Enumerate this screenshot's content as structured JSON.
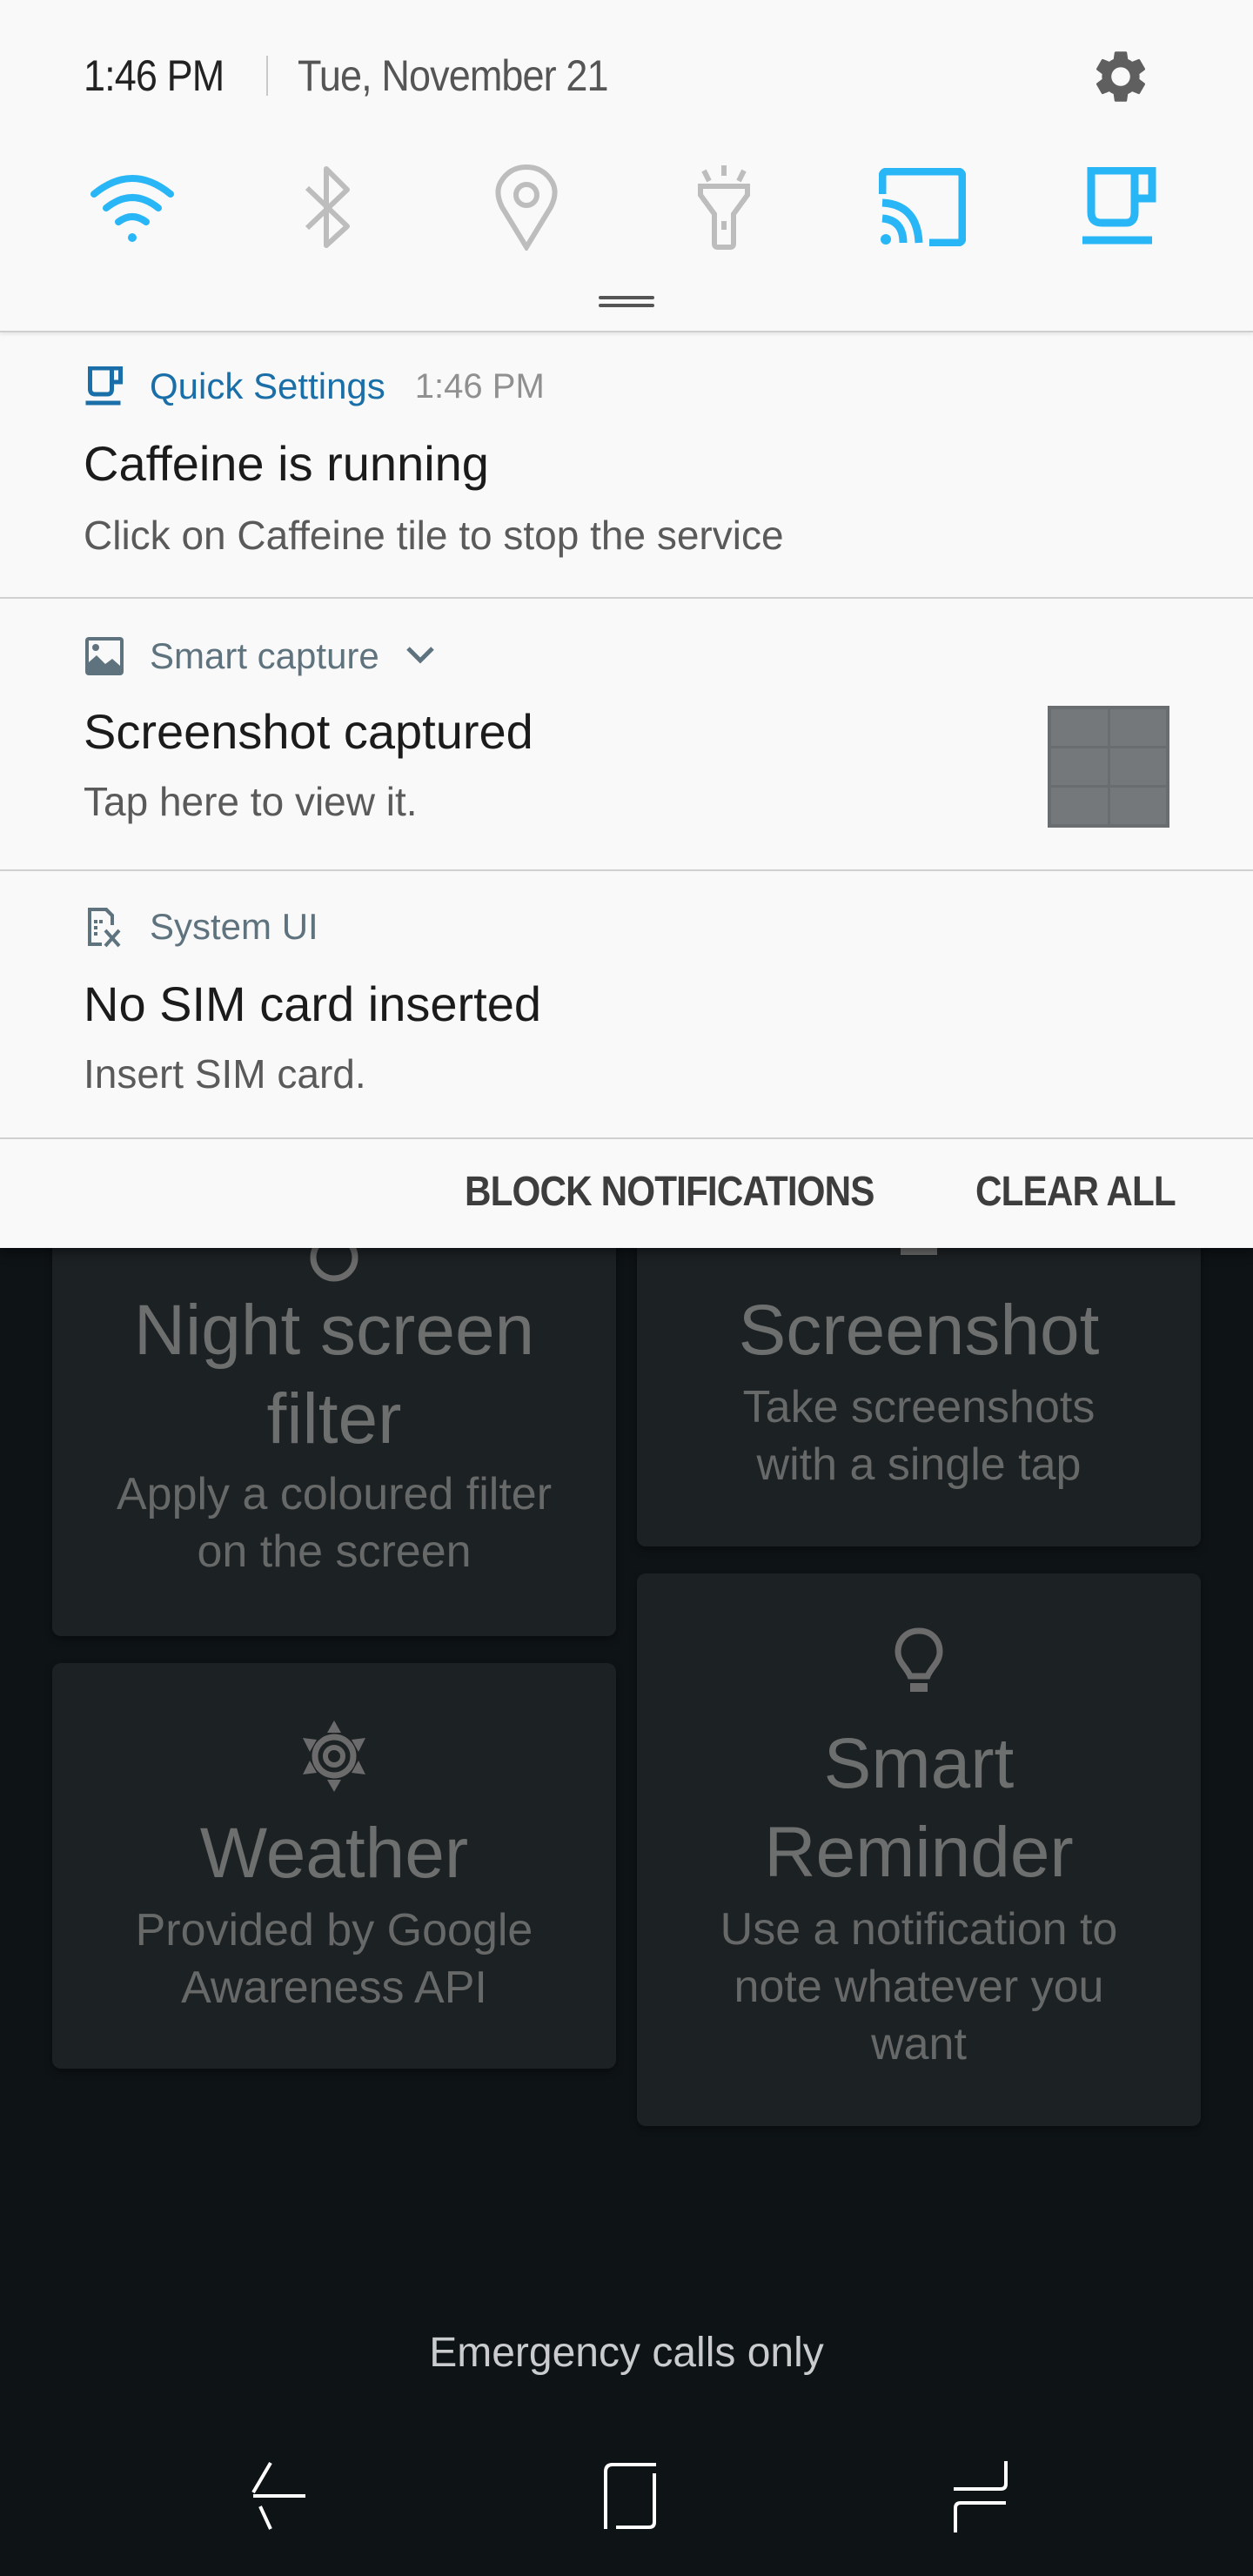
{
  "status_header": {
    "time": "1:46 PM",
    "date": "Tue, November 21",
    "settings_icon": "gear-icon"
  },
  "quick_toggles": [
    {
      "name": "wifi",
      "icon": "wifi-icon",
      "state": "on"
    },
    {
      "name": "bluetooth",
      "icon": "bluetooth-icon",
      "state": "off"
    },
    {
      "name": "location",
      "icon": "location-icon",
      "state": "off"
    },
    {
      "name": "flashlight",
      "icon": "flashlight-icon",
      "state": "off"
    },
    {
      "name": "cast",
      "icon": "cast-icon",
      "state": "on"
    },
    {
      "name": "caffeine",
      "icon": "coffee-cup-icon",
      "state": "on"
    }
  ],
  "colors": {
    "toggle_on": "#29b6f6",
    "toggle_off": "#bdbdbd",
    "quick_settings_app": "#1a6fa8",
    "app_name": "#5f737e",
    "panel_bg": "#f9f9f9",
    "background": "#0e1316",
    "tile_bg": "#1c2124"
  },
  "notifications": [
    {
      "app_name": "Quick Settings",
      "time": "1:46 PM",
      "icon": "coffee-cup-icon",
      "title": "Caffeine is running",
      "body": "Click on Caffeine tile to stop the service"
    },
    {
      "app_name": "Smart capture",
      "icon": "image-icon",
      "expandable": true,
      "title": "Screenshot captured",
      "body": "Tap here to view it.",
      "has_thumbnail": true
    },
    {
      "app_name": "System UI",
      "icon": "no-sim-icon",
      "title": "No SIM card inserted",
      "body": "Insert SIM card."
    }
  ],
  "actions": {
    "block": "BLOCK NOTIFICATIONS",
    "clear_all": "CLEAR ALL"
  },
  "background_tiles": [
    {
      "title": "Night screen filter",
      "title_lines": [
        "Night screen",
        "filter"
      ],
      "subtitle_lines": [
        "Apply a coloured filter",
        "on the screen"
      ],
      "icon": "night-filter-icon"
    },
    {
      "title": "Screenshot",
      "title_lines": [
        "Screenshot"
      ],
      "subtitle_lines": [
        "Take screenshots",
        "with a single tap"
      ],
      "icon": "screenshot-icon"
    },
    {
      "title": "Weather",
      "title_lines": [
        "Weather"
      ],
      "subtitle_lines": [
        "Provided by Google",
        "Awareness API"
      ],
      "icon": "weather-sun-icon"
    },
    {
      "title": "Smart Reminder",
      "title_lines": [
        "Smart",
        "Reminder"
      ],
      "subtitle_lines": [
        "Use a notification to",
        "note whatever you",
        "want"
      ],
      "icon": "lightbulb-icon"
    }
  ],
  "lock_status": "Emergency calls only",
  "nav_bar": {
    "back": "back-icon",
    "home": "home-icon",
    "recents": "recents-icon"
  }
}
